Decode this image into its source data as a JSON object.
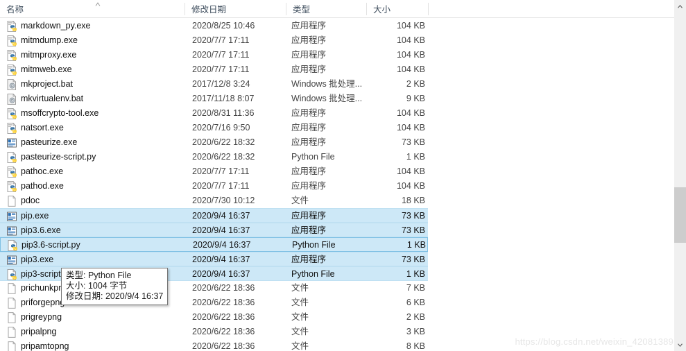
{
  "header": {
    "columns": [
      {
        "label": "名称",
        "name": "column-header-name"
      },
      {
        "label": "修改日期",
        "name": "column-header-date-modified"
      },
      {
        "label": "类型",
        "name": "column-header-type"
      },
      {
        "label": "大小",
        "name": "column-header-size"
      }
    ],
    "sort_indicator": "ascending"
  },
  "files": [
    {
      "name": "markdown_py.exe",
      "date": "2020/8/25 10:46",
      "type": "应用程序",
      "size": "104 KB",
      "icon": "python-exe-icon",
      "selected": false,
      "focused": false
    },
    {
      "name": "mitmdump.exe",
      "date": "2020/7/7 17:11",
      "type": "应用程序",
      "size": "104 KB",
      "icon": "python-exe-icon",
      "selected": false,
      "focused": false
    },
    {
      "name": "mitmproxy.exe",
      "date": "2020/7/7 17:11",
      "type": "应用程序",
      "size": "104 KB",
      "icon": "python-exe-icon",
      "selected": false,
      "focused": false
    },
    {
      "name": "mitmweb.exe",
      "date": "2020/7/7 17:11",
      "type": "应用程序",
      "size": "104 KB",
      "icon": "python-exe-icon",
      "selected": false,
      "focused": false
    },
    {
      "name": "mkproject.bat",
      "date": "2017/12/8 3:24",
      "type": "Windows 批处理...",
      "size": "2 KB",
      "icon": "batch-file-icon",
      "selected": false,
      "focused": false
    },
    {
      "name": "mkvirtualenv.bat",
      "date": "2017/11/18 8:07",
      "type": "Windows 批处理...",
      "size": "9 KB",
      "icon": "batch-file-icon",
      "selected": false,
      "focused": false
    },
    {
      "name": "msoffcrypto-tool.exe",
      "date": "2020/8/31 11:36",
      "type": "应用程序",
      "size": "104 KB",
      "icon": "python-exe-icon",
      "selected": false,
      "focused": false
    },
    {
      "name": "natsort.exe",
      "date": "2020/7/16 9:50",
      "type": "应用程序",
      "size": "104 KB",
      "icon": "python-exe-icon",
      "selected": false,
      "focused": false
    },
    {
      "name": "pasteurize.exe",
      "date": "2020/6/22 18:32",
      "type": "应用程序",
      "size": "73 KB",
      "icon": "application-icon",
      "selected": false,
      "focused": false
    },
    {
      "name": "pasteurize-script.py",
      "date": "2020/6/22 18:32",
      "type": "Python File",
      "size": "1 KB",
      "icon": "python-script-icon",
      "selected": false,
      "focused": false
    },
    {
      "name": "pathoc.exe",
      "date": "2020/7/7 17:11",
      "type": "应用程序",
      "size": "104 KB",
      "icon": "python-exe-icon",
      "selected": false,
      "focused": false
    },
    {
      "name": "pathod.exe",
      "date": "2020/7/7 17:11",
      "type": "应用程序",
      "size": "104 KB",
      "icon": "python-exe-icon",
      "selected": false,
      "focused": false
    },
    {
      "name": "pdoc",
      "date": "2020/7/30 10:12",
      "type": "文件",
      "size": "18 KB",
      "icon": "generic-file-icon",
      "selected": false,
      "focused": false
    },
    {
      "name": "pip.exe",
      "date": "2020/9/4 16:37",
      "type": "应用程序",
      "size": "73 KB",
      "icon": "application-icon",
      "selected": true,
      "focused": false
    },
    {
      "name": "pip3.6.exe",
      "date": "2020/9/4 16:37",
      "type": "应用程序",
      "size": "73 KB",
      "icon": "application-icon",
      "selected": true,
      "focused": false
    },
    {
      "name": "pip3.6-script.py",
      "date": "2020/9/4 16:37",
      "type": "Python File",
      "size": "1 KB",
      "icon": "python-script-icon",
      "selected": true,
      "focused": true
    },
    {
      "name": "pip3.exe",
      "date": "2020/9/4 16:37",
      "type": "应用程序",
      "size": "73 KB",
      "icon": "application-icon",
      "selected": true,
      "focused": false
    },
    {
      "name": "pip3-script.py",
      "date": "2020/9/4 16:37",
      "type": "Python File",
      "size": "1 KB",
      "icon": "python-script-icon",
      "selected": true,
      "focused": false
    },
    {
      "name": "prichunkpng",
      "date": "2020/6/22 18:36",
      "type": "文件",
      "size": "7 KB",
      "icon": "generic-file-icon",
      "selected": false,
      "focused": false
    },
    {
      "name": "priforgepng",
      "date": "2020/6/22 18:36",
      "type": "文件",
      "size": "6 KB",
      "icon": "generic-file-icon",
      "selected": false,
      "focused": false
    },
    {
      "name": "prigreypng",
      "date": "2020/6/22 18:36",
      "type": "文件",
      "size": "2 KB",
      "icon": "generic-file-icon",
      "selected": false,
      "focused": false
    },
    {
      "name": "pripalpng",
      "date": "2020/6/22 18:36",
      "type": "文件",
      "size": "3 KB",
      "icon": "generic-file-icon",
      "selected": false,
      "focused": false
    },
    {
      "name": "pripamtopng",
      "date": "2020/6/22 18:36",
      "type": "文件",
      "size": "8 KB",
      "icon": "generic-file-icon",
      "selected": false,
      "focused": false
    }
  ],
  "tooltip": {
    "type_line": "类型: Python File",
    "size_line": "大小: 1004 字节",
    "date_line": "修改日期: 2020/9/4 16:37"
  },
  "scrollbar": {
    "up_arrow": "▲",
    "down_arrow": "▼"
  },
  "watermark": {
    "text": "https://blog.csdn.net/weixin_42081389"
  },
  "colors": {
    "selection": "#cde8f7",
    "selection_border": "#7fc0e4",
    "header_text": "#3b4a5a",
    "scrollbar_thumb": "#cdcdcd"
  }
}
